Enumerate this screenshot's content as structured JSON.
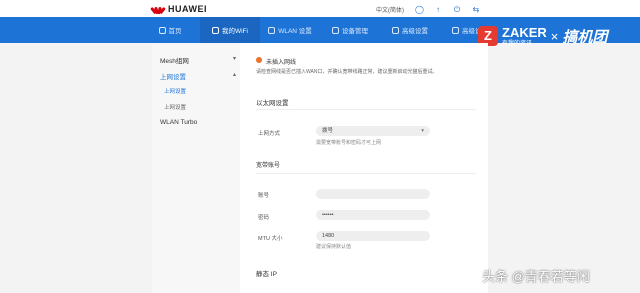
{
  "brand": {
    "name": "HUAWEI"
  },
  "top_actions": {
    "language": "中文(简体)"
  },
  "nav": {
    "items": [
      {
        "label": "首页",
        "icon": "home-icon"
      },
      {
        "label": "我的WiFi",
        "icon": "wifi-icon"
      },
      {
        "label": "WLAN 设置",
        "icon": "wlan-icon"
      },
      {
        "label": "设备管理",
        "icon": "device-icon"
      },
      {
        "label": "高级设置",
        "icon": "gear-icon"
      },
      {
        "label": "高级设置",
        "icon": "settings-icon"
      }
    ]
  },
  "watermark": {
    "z": "Z",
    "zaker": "ZAKER",
    "zaker_sub": "有趣的资讯",
    "x": "×",
    "brand": "搞机团",
    "footer": "头条 @青春若等闲"
  },
  "sidebar": {
    "item1": "Mesh组网",
    "item2": "上网设置",
    "sub1": "上网设置",
    "sub2": "上网设置",
    "item3": "WLAN Turbo"
  },
  "main": {
    "status_title": "未插入网线",
    "status_desc": "请检查网线是否已插入WAN口，并确认宽带线路正常，建议重新启动光猫后重试。",
    "section1": "以太网设置",
    "mode_label": "上网方式",
    "mode_value": "拨号",
    "mode_hint": "需要宽带账号和密码才可上网",
    "section2": "宽带账号",
    "account_label": "账号",
    "password_label": "密码",
    "password_value": "••••••",
    "mtu_label": "MTU 大小",
    "mtu_value": "1480",
    "mtu_hint": "建议保持默认值",
    "section3": "静态 IP"
  }
}
